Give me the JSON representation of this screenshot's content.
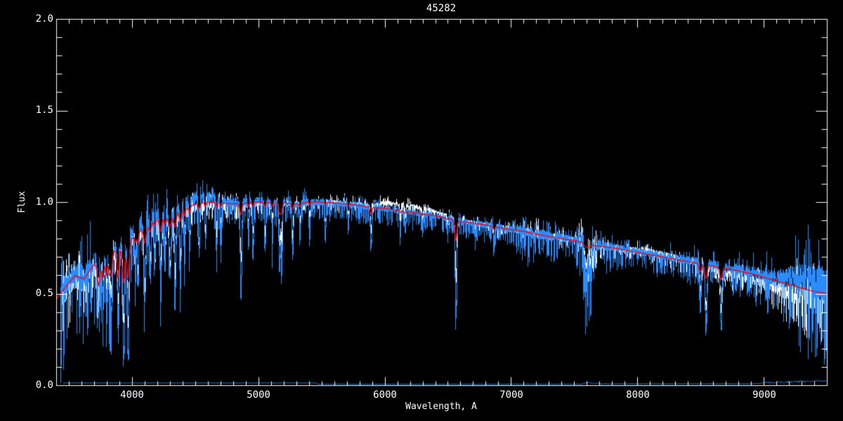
{
  "chart_data": {
    "type": "line",
    "title": "45282",
    "xlabel": "Wavelength, A",
    "ylabel": "Flux",
    "xlim": [
      3400,
      9500
    ],
    "ylim": [
      0.0,
      2.0
    ],
    "x_major_ticks": [
      4000,
      5000,
      6000,
      7000,
      8000,
      9000
    ],
    "xtick_labels": [
      "4000",
      "5000",
      "6000",
      "7000",
      "8000",
      "9000"
    ],
    "y_major_ticks": [
      2.0,
      1.5,
      1.0,
      0.5,
      0.0
    ],
    "ytick_labels": [
      "2.0",
      "1.5",
      "1.0",
      "0.5",
      "0.0"
    ],
    "x_minor_step": 100,
    "y_minor_step": 0.1,
    "grid": false,
    "legend": "none",
    "colors": {
      "background": "#000000",
      "axis": "#ffffff",
      "observed": "#2b8cff",
      "smoothed": "#ffffff",
      "model": "#ff0000"
    },
    "series": [
      {
        "name": "observed-spectrum",
        "color": "#2b8cff",
        "style": "noisy-line"
      },
      {
        "name": "smoothed-spectrum",
        "color": "#ffffff",
        "style": "noisy-line"
      },
      {
        "name": "model-fit",
        "color": "#ff0000",
        "style": "smooth-line"
      },
      {
        "name": "error-spectrum",
        "color": "#2b8cff",
        "style": "flat-line-near-zero"
      }
    ],
    "continuum": [
      [
        3400,
        0.47
      ],
      [
        3480,
        0.54
      ],
      [
        3550,
        0.6
      ],
      [
        3620,
        0.58
      ],
      [
        3700,
        0.66
      ],
      [
        3760,
        0.63
      ],
      [
        3820,
        0.72
      ],
      [
        3880,
        0.74
      ],
      [
        3940,
        0.77
      ],
      [
        4000,
        0.8
      ],
      [
        4060,
        0.84
      ],
      [
        4120,
        0.86
      ],
      [
        4180,
        0.9
      ],
      [
        4260,
        0.91
      ],
      [
        4340,
        0.93
      ],
      [
        4420,
        0.96
      ],
      [
        4500,
        0.99
      ],
      [
        4600,
        1.0
      ],
      [
        4700,
        0.995
      ],
      [
        4800,
        0.99
      ],
      [
        4900,
        0.995
      ],
      [
        5000,
        1.0
      ],
      [
        5100,
        0.995
      ],
      [
        5200,
        0.995
      ],
      [
        5300,
        0.99
      ],
      [
        5400,
        1.0
      ],
      [
        5500,
        1.0
      ],
      [
        5600,
        0.995
      ],
      [
        5700,
        0.99
      ],
      [
        5800,
        0.98
      ],
      [
        5900,
        0.97
      ],
      [
        6000,
        0.965
      ],
      [
        6100,
        0.955
      ],
      [
        6200,
        0.945
      ],
      [
        6300,
        0.935
      ],
      [
        6400,
        0.925
      ],
      [
        6500,
        0.91
      ],
      [
        6600,
        0.895
      ],
      [
        6700,
        0.885
      ],
      [
        6800,
        0.875
      ],
      [
        6900,
        0.862
      ],
      [
        7000,
        0.85
      ],
      [
        7100,
        0.84
      ],
      [
        7200,
        0.825
      ],
      [
        7300,
        0.812
      ],
      [
        7400,
        0.8
      ],
      [
        7500,
        0.79
      ],
      [
        7600,
        0.775
      ],
      [
        7700,
        0.76
      ],
      [
        7800,
        0.75
      ],
      [
        7900,
        0.738
      ],
      [
        8000,
        0.725
      ],
      [
        8100,
        0.712
      ],
      [
        8200,
        0.7
      ],
      [
        8300,
        0.687
      ],
      [
        8400,
        0.675
      ],
      [
        8500,
        0.662
      ],
      [
        8600,
        0.65
      ],
      [
        8700,
        0.638
      ],
      [
        8800,
        0.625
      ],
      [
        8900,
        0.61
      ],
      [
        9000,
        0.59
      ],
      [
        9100,
        0.57
      ],
      [
        9200,
        0.55
      ],
      [
        9300,
        0.53
      ],
      [
        9400,
        0.512
      ],
      [
        9500,
        0.5
      ]
    ],
    "absorption_lines": [
      [
        3735,
        0.4,
        6,
        0.4
      ],
      [
        3770,
        0.46,
        5,
        0.35
      ],
      [
        3798,
        0.42,
        5,
        0.3
      ],
      [
        3820,
        0.45,
        5,
        0.3
      ],
      [
        3835,
        0.38,
        6,
        0.35
      ],
      [
        3889,
        0.3,
        6,
        0.35
      ],
      [
        3933,
        0.08,
        7,
        0.3
      ],
      [
        3968,
        0.12,
        7,
        0.3
      ],
      [
        4026,
        0.55,
        4,
        0.15
      ],
      [
        4045,
        0.5,
        5,
        0.15
      ],
      [
        4101,
        0.42,
        7,
        0.18
      ],
      [
        4144,
        0.55,
        5,
        0.12
      ],
      [
        4180,
        0.6,
        4,
        0.1
      ],
      [
        4226,
        0.45,
        6,
        0.15
      ],
      [
        4260,
        0.58,
        4,
        0.1
      ],
      [
        4300,
        0.55,
        8,
        0.15
      ],
      [
        4340,
        0.48,
        6,
        0.15
      ],
      [
        4383,
        0.52,
        5,
        0.12
      ],
      [
        4415,
        0.62,
        4,
        0.1
      ],
      [
        4455,
        0.65,
        4,
        0.1
      ],
      [
        4530,
        0.68,
        5,
        0.1
      ],
      [
        4580,
        0.72,
        4,
        0.08
      ],
      [
        4668,
        0.7,
        4,
        0.1
      ],
      [
        4703,
        0.74,
        4,
        0.08
      ],
      [
        4861,
        0.48,
        6,
        0.12
      ],
      [
        4920,
        0.74,
        4,
        0.08
      ],
      [
        4957,
        0.72,
        4,
        0.08
      ],
      [
        5051,
        0.7,
        4,
        0.08
      ],
      [
        5110,
        0.75,
        4,
        0.08
      ],
      [
        5167,
        0.62,
        5,
        0.15
      ],
      [
        5183,
        0.61,
        5,
        0.15
      ],
      [
        5270,
        0.7,
        5,
        0.1
      ],
      [
        5328,
        0.77,
        4,
        0.08
      ],
      [
        5405,
        0.8,
        4,
        0.08
      ],
      [
        5530,
        0.82,
        4,
        0.06
      ],
      [
        5711,
        0.84,
        4,
        0.06
      ],
      [
        5890,
        0.72,
        5,
        0.15
      ],
      [
        6122,
        0.82,
        4,
        0.08
      ],
      [
        6162,
        0.83,
        4,
        0.08
      ],
      [
        6300,
        0.85,
        4,
        0.06
      ],
      [
        6495,
        0.84,
        4,
        0.06
      ],
      [
        6563,
        0.35,
        6,
        0.2
      ],
      [
        6717,
        0.82,
        4,
        0.06
      ],
      [
        6867,
        0.76,
        6,
        0.12
      ],
      [
        7180,
        0.79,
        7,
        0.06
      ],
      [
        7594,
        0.55,
        10,
        0.1
      ],
      [
        7625,
        0.6,
        8,
        0.08
      ],
      [
        7665,
        0.66,
        6,
        0.06
      ],
      [
        8227,
        0.76,
        4,
        0.06
      ],
      [
        8327,
        0.74,
        4,
        0.06
      ],
      [
        8433,
        0.72,
        4,
        0.06
      ],
      [
        8498,
        0.44,
        6,
        0.2
      ],
      [
        8542,
        0.28,
        7,
        0.2
      ],
      [
        8662,
        0.3,
        7,
        0.2
      ],
      [
        8688,
        0.58,
        4,
        0.1
      ],
      [
        8750,
        0.62,
        4,
        0.1
      ],
      [
        8807,
        0.66,
        4,
        0.08
      ],
      [
        9061,
        0.6,
        5,
        0.06
      ],
      [
        9150,
        0.62,
        5,
        0.06
      ]
    ],
    "noise_amplitude": [
      [
        3400,
        0.09
      ],
      [
        3700,
        0.07
      ],
      [
        3900,
        0.05
      ],
      [
        4100,
        0.045
      ],
      [
        4500,
        0.035
      ],
      [
        5000,
        0.025
      ],
      [
        5500,
        0.02
      ],
      [
        6000,
        0.018
      ],
      [
        6500,
        0.018
      ],
      [
        7000,
        0.02
      ],
      [
        7140,
        0.035
      ],
      [
        7250,
        0.03
      ],
      [
        7500,
        0.02
      ],
      [
        7600,
        0.07
      ],
      [
        7700,
        0.03
      ],
      [
        8000,
        0.02
      ],
      [
        8200,
        0.025
      ],
      [
        8500,
        0.025
      ],
      [
        8800,
        0.03
      ],
      [
        9000,
        0.035
      ],
      [
        9200,
        0.06
      ],
      [
        9350,
        0.09
      ],
      [
        9500,
        0.1
      ]
    ],
    "observed_offset": [
      [
        3400,
        0.0
      ],
      [
        3950,
        0.01
      ],
      [
        4100,
        0.04
      ],
      [
        4500,
        0.04
      ],
      [
        4800,
        0.01
      ],
      [
        5200,
        0.0
      ],
      [
        6500,
        0.0
      ],
      [
        9100,
        0.01
      ],
      [
        9300,
        0.06
      ],
      [
        9500,
        0.05
      ]
    ],
    "smoothed_offset": [
      [
        3400,
        -0.01
      ],
      [
        4100,
        -0.02
      ],
      [
        4600,
        -0.02
      ],
      [
        5000,
        -0.005
      ],
      [
        5850,
        0.005
      ],
      [
        6000,
        0.03
      ],
      [
        6250,
        0.035
      ],
      [
        6450,
        0.015
      ],
      [
        6600,
        0.0
      ],
      [
        7900,
        0.005
      ],
      [
        8050,
        0.02
      ],
      [
        8250,
        0.01
      ],
      [
        8500,
        -0.01
      ],
      [
        8800,
        -0.03
      ],
      [
        9200,
        -0.04
      ],
      [
        9500,
        -0.04
      ]
    ],
    "error_level": [
      [
        3450,
        0.012
      ],
      [
        5460,
        0.012
      ],
      [
        5470,
        0.006
      ],
      [
        7550,
        0.006
      ],
      [
        7600,
        0.015
      ],
      [
        7700,
        0.008
      ],
      [
        8900,
        0.008
      ],
      [
        9100,
        0.015
      ],
      [
        9300,
        0.02
      ],
      [
        9500,
        0.025
      ]
    ],
    "data_start_wavelength": 3435,
    "seeds": {
      "observed": 7,
      "smoothed": 13,
      "error": 99
    }
  }
}
